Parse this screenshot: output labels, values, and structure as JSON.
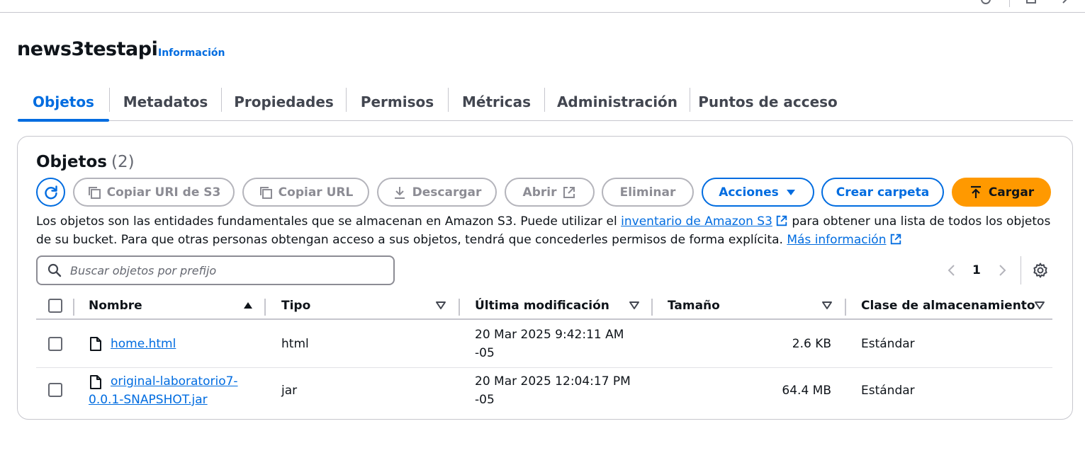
{
  "bucket": {
    "name": "news3testapi",
    "info_link": "Información"
  },
  "tabs": [
    {
      "label": "Objetos",
      "active": true
    },
    {
      "label": "Metadatos"
    },
    {
      "label": "Propiedades"
    },
    {
      "label": "Permisos"
    },
    {
      "label": "Métricas"
    },
    {
      "label": "Administración"
    },
    {
      "label": "Puntos de acceso"
    }
  ],
  "objects_panel": {
    "title": "Objetos",
    "count": "(2)",
    "buttons": {
      "refresh_icon": "refresh-icon",
      "copy_uri": "Copiar URI de S3",
      "copy_url": "Copiar URL",
      "download": "Descargar",
      "open": "Abrir",
      "delete": "Eliminar",
      "actions": "Acciones",
      "create_folder": "Crear carpeta",
      "upload": "Cargar"
    },
    "description": {
      "part1": "Los objetos son las entidades fundamentales que se almacenan en Amazon S3. Puede utilizar el ",
      "link1": "inventario de Amazon S3",
      "part2": " para obtener una lista de todos los objetos de su bucket. Para que otras personas obtengan acceso a sus objetos, tendrá que concederles permisos de forma explícita. ",
      "link2": "Más información"
    },
    "search": {
      "placeholder": "Buscar objetos por prefijo",
      "value": ""
    },
    "pagination": {
      "current_page": "1"
    },
    "table": {
      "columns": {
        "name": "Nombre",
        "type": "Tipo",
        "modified": "Última modificación",
        "size": "Tamaño",
        "storage_class": "Clase de almacenamiento"
      },
      "rows": [
        {
          "name": "home.html",
          "type": "html",
          "modified_line1": "20 Mar 2025 9:42:11 AM",
          "modified_line2": "-05",
          "size": "2.6 KB",
          "storage_class": "Estándar"
        },
        {
          "name_line1": "original-laboratorio7-",
          "name_line2": "0.0.1-SNAPSHOT.jar",
          "type": "jar",
          "modified_line1": "20 Mar 2025 12:04:17 PM",
          "modified_line2": "-05",
          "size": "64.4 MB",
          "storage_class": "Estándar"
        }
      ]
    }
  },
  "colors": {
    "accent": "#006ce0",
    "upload_button": "#ff9900",
    "text": "#0f141a",
    "disabled": "#8c8c94"
  }
}
